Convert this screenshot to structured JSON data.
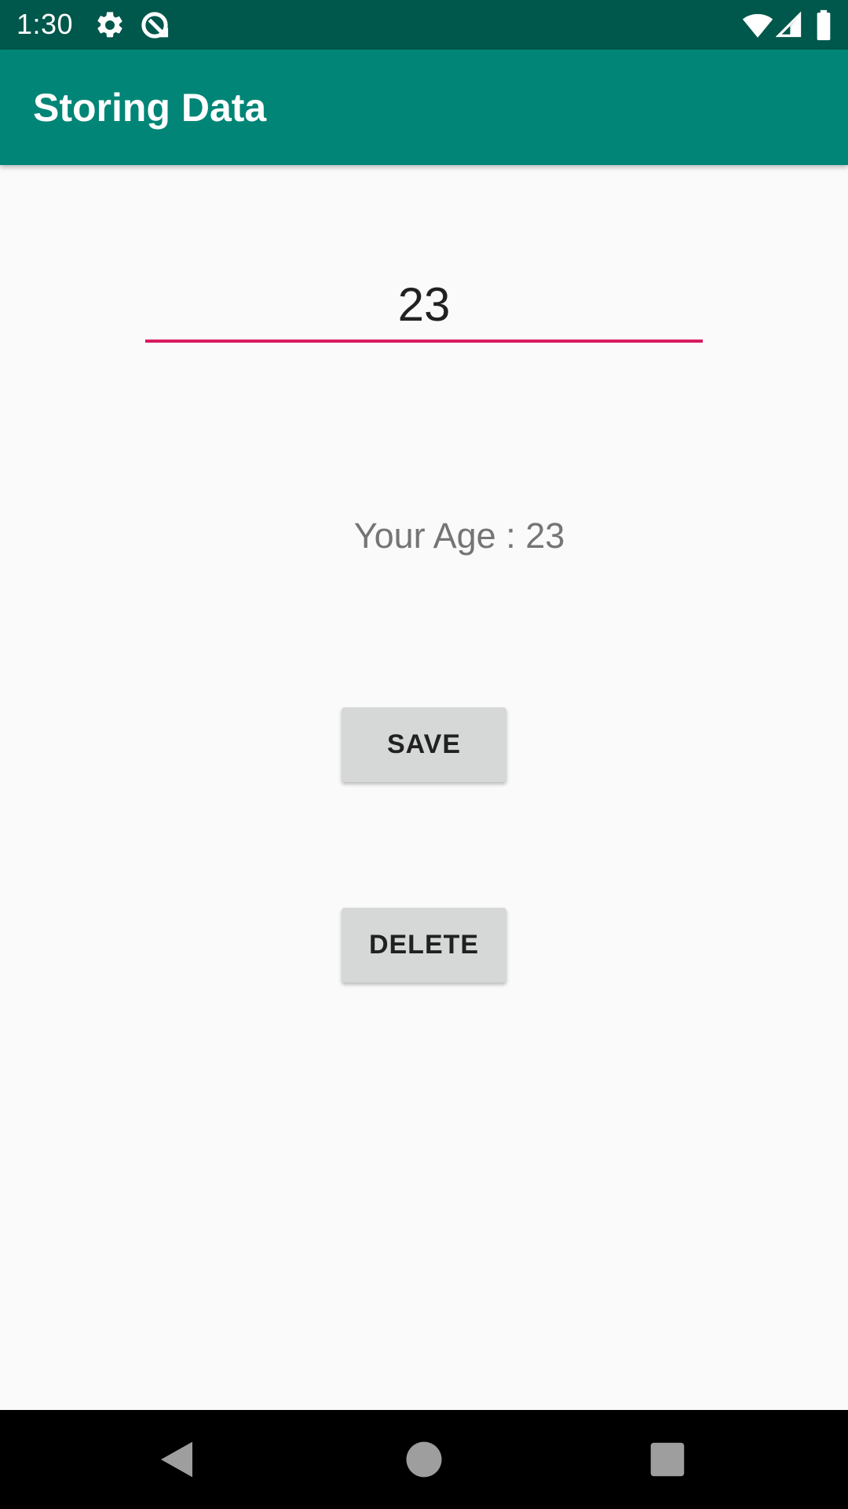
{
  "status_bar": {
    "time": "1:30",
    "icons": [
      "settings-icon",
      "sync-icon",
      "wifi-icon",
      "signal-icon",
      "battery-icon"
    ]
  },
  "app_bar": {
    "title": "Storing Data",
    "color": "#008577"
  },
  "form": {
    "age_input_value": "23",
    "age_display_text": "Your Age : 23",
    "accent_color": "#d81b60"
  },
  "buttons": {
    "save_label": "SAVE",
    "delete_label": "DELETE"
  },
  "nav_bar": {
    "icons": [
      "back-icon",
      "home-icon",
      "recents-icon"
    ]
  }
}
